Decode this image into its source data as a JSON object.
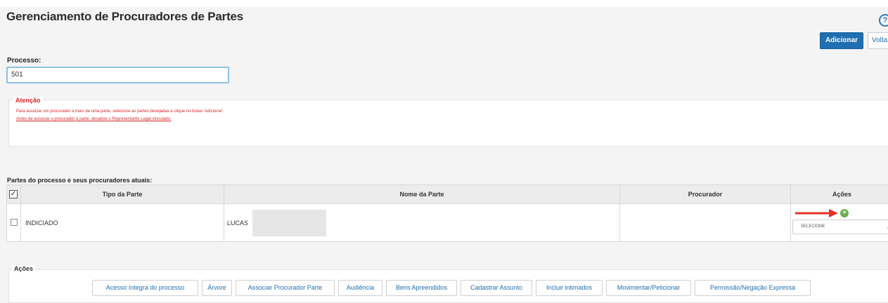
{
  "page": {
    "title": "Gerenciamento de Procuradores de Partes"
  },
  "header": {
    "help_icon": "question-circle-icon",
    "help_glyph": "?"
  },
  "toolbar": {
    "adicionar_label": "Adicionar",
    "voltar_label": "Volta"
  },
  "processo": {
    "label": "Processo:",
    "value": "501"
  },
  "alert": {
    "title": "Atenção",
    "line1": "Para associar um procurador a mais de uma parte, selecione as partes desejadas e clique no botao 'Adicionar'.",
    "line2": "Antes de associar o procurador à parte, desative o Representante Legal vinculado.",
    "color": "#d9262a"
  },
  "partes": {
    "section_label": "Partes do processo e seus procuradores atuais:",
    "header_check": "✓",
    "columns": [
      "Tipo da Parte",
      "Nome da Parte",
      "Procurador",
      "Ações"
    ],
    "rows": [
      {
        "tipo": "INDICIADO",
        "nome": "LUCAS",
        "procurador": "",
        "select_value": "SELECIONE",
        "add_icon": "plus-circle-icon",
        "add_glyph": "+"
      }
    ]
  },
  "acoes": {
    "title": "Ações",
    "buttons": [
      "Acesso íntegra do processo",
      "Árvore",
      "Associar Procurador Parte",
      "Audiência",
      "Bens Apreendidos",
      "Cadastrar Assunto",
      "Incluir intimados",
      "Movimentar/Peticionar",
      "Permissão/Negação Expressa"
    ]
  },
  "colors": {
    "primary": "#1f6fb2",
    "link": "#1f6fb2",
    "annotation_arrow": "#e8312a",
    "add_green": "#6ab04c"
  }
}
